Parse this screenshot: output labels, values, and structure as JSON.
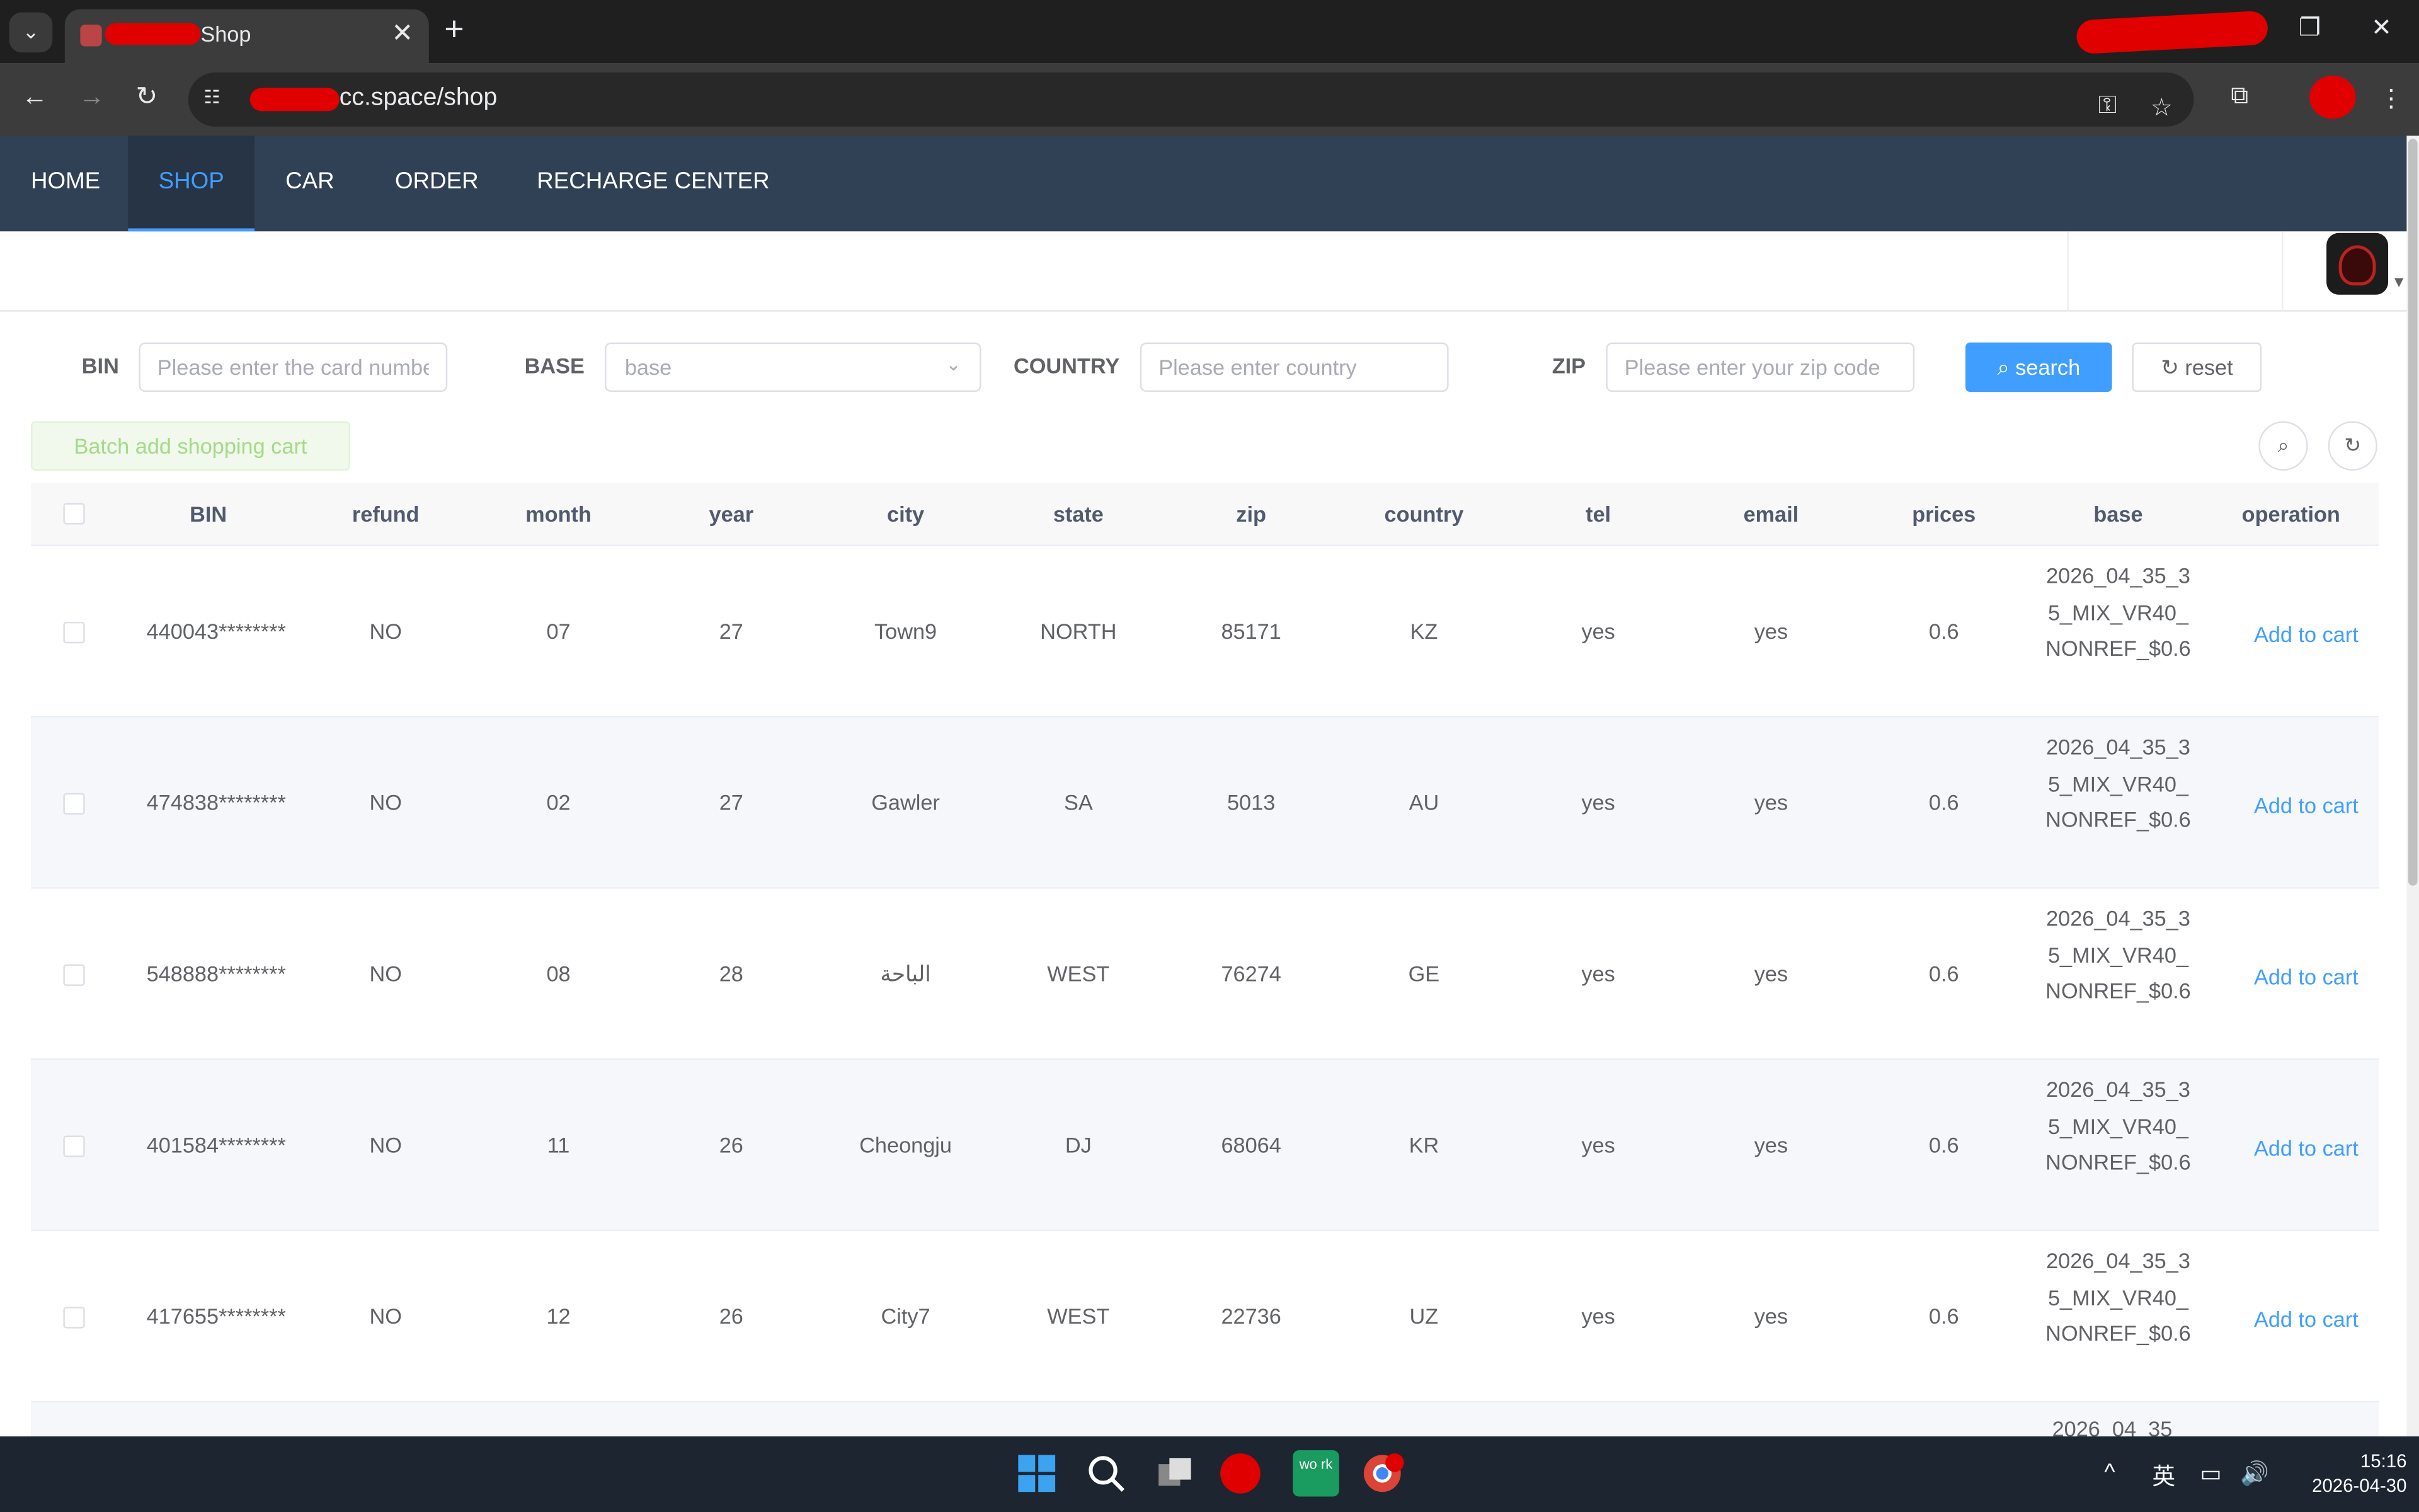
{
  "browser": {
    "tab_title": "Shop",
    "url_text": "cc.space/shop",
    "new_tab_symbol": "+",
    "close_symbol": "✕"
  },
  "nav": {
    "items": [
      {
        "label": "HOME"
      },
      {
        "label": "SHOP",
        "active": true
      },
      {
        "label": "CAR"
      },
      {
        "label": "ORDER"
      },
      {
        "label": "RECHARGE CENTER"
      }
    ]
  },
  "search": {
    "bin_label": "BIN",
    "bin_placeholder": "Please enter the card number",
    "base_label": "BASE",
    "base_placeholder": "base",
    "country_label": "COUNTRY",
    "country_placeholder": "Please enter country",
    "zip_label": "ZIP",
    "zip_placeholder": "Please enter your zip code",
    "search_button": "search",
    "reset_button": "reset",
    "batch_button": "Batch add shopping cart"
  },
  "table": {
    "columns": [
      "BIN",
      "refund",
      "month",
      "year",
      "city",
      "state",
      "zip",
      "country",
      "tel",
      "email",
      "prices",
      "base",
      "operation"
    ],
    "rows": [
      {
        "bin": "440043********",
        "refund": "NO",
        "month": "07",
        "year": "27",
        "city": "Town9",
        "state": "NORTH",
        "zip": "85171",
        "country": "KZ",
        "tel": "yes",
        "email": "yes",
        "price": "0.6",
        "base": "2026_04_35_35_MIX_VR40_NONREF_$0.6",
        "action": "Add to cart"
      },
      {
        "bin": "474838********",
        "refund": "NO",
        "month": "02",
        "year": "27",
        "city": "Gawler",
        "state": "SA",
        "zip": "5013",
        "country": "AU",
        "tel": "yes",
        "email": "yes",
        "price": "0.6",
        "base": "2026_04_35_35_MIX_VR40_NONREF_$0.6",
        "action": "Add to cart"
      },
      {
        "bin": "548888********",
        "refund": "NO",
        "month": "08",
        "year": "28",
        "city": "الباحة",
        "state": "WEST",
        "zip": "76274",
        "country": "GE",
        "tel": "yes",
        "email": "yes",
        "price": "0.6",
        "base": "2026_04_35_35_MIX_VR40_NONREF_$0.6",
        "action": "Add to cart"
      },
      {
        "bin": "401584********",
        "refund": "NO",
        "month": "11",
        "year": "26",
        "city": "Cheongju",
        "state": "DJ",
        "zip": "68064",
        "country": "KR",
        "tel": "yes",
        "email": "yes",
        "price": "0.6",
        "base": "2026_04_35_35_MIX_VR40_NONREF_$0.6",
        "action": "Add to cart"
      },
      {
        "bin": "417655********",
        "refund": "NO",
        "month": "12",
        "year": "26",
        "city": "City7",
        "state": "WEST",
        "zip": "22736",
        "country": "UZ",
        "tel": "yes",
        "email": "yes",
        "price": "0.6",
        "base": "2026_04_35_35_MIX_VR40_NONREF_$0.6",
        "action": "Add to cart"
      }
    ],
    "partial_row_text": "2026_04_35_"
  },
  "taskbar": {
    "ime": "英",
    "time": "15:16",
    "date": "2026-04-30",
    "work_icon_text": "wo rk"
  },
  "colors": {
    "nav_bg": "#304156",
    "accent": "#409eff",
    "batch_bg": "#f0f9eb"
  }
}
